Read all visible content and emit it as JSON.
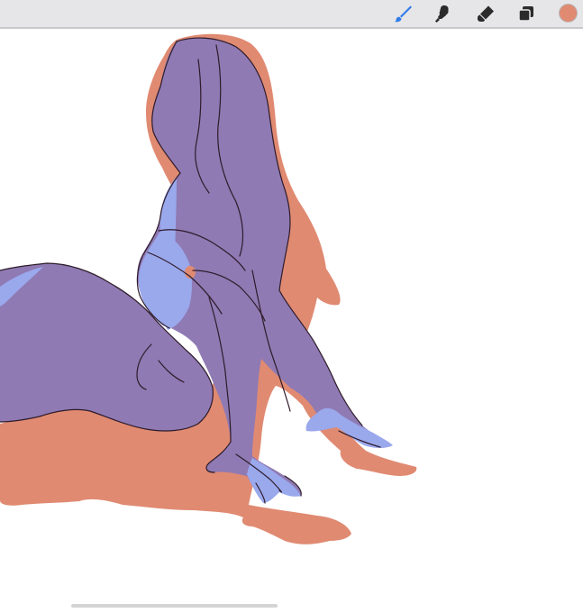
{
  "toolbar": {
    "tools": [
      {
        "name": "brush-icon",
        "active": true
      },
      {
        "name": "smudge-icon",
        "active": false
      },
      {
        "name": "eraser-icon",
        "active": false
      },
      {
        "name": "layers-icon",
        "active": false
      }
    ],
    "current_color": "#E08A72"
  },
  "colors": {
    "toolbar_bg": "#E6E6E8",
    "active_tool": "#2F7BE8",
    "inactive_tool": "#2B2B2B",
    "layer_orange": "#E08A72",
    "layer_purple": "#8F7AB3",
    "layer_blue": "#9AA8EC",
    "line_art": "#2E1B2A"
  }
}
